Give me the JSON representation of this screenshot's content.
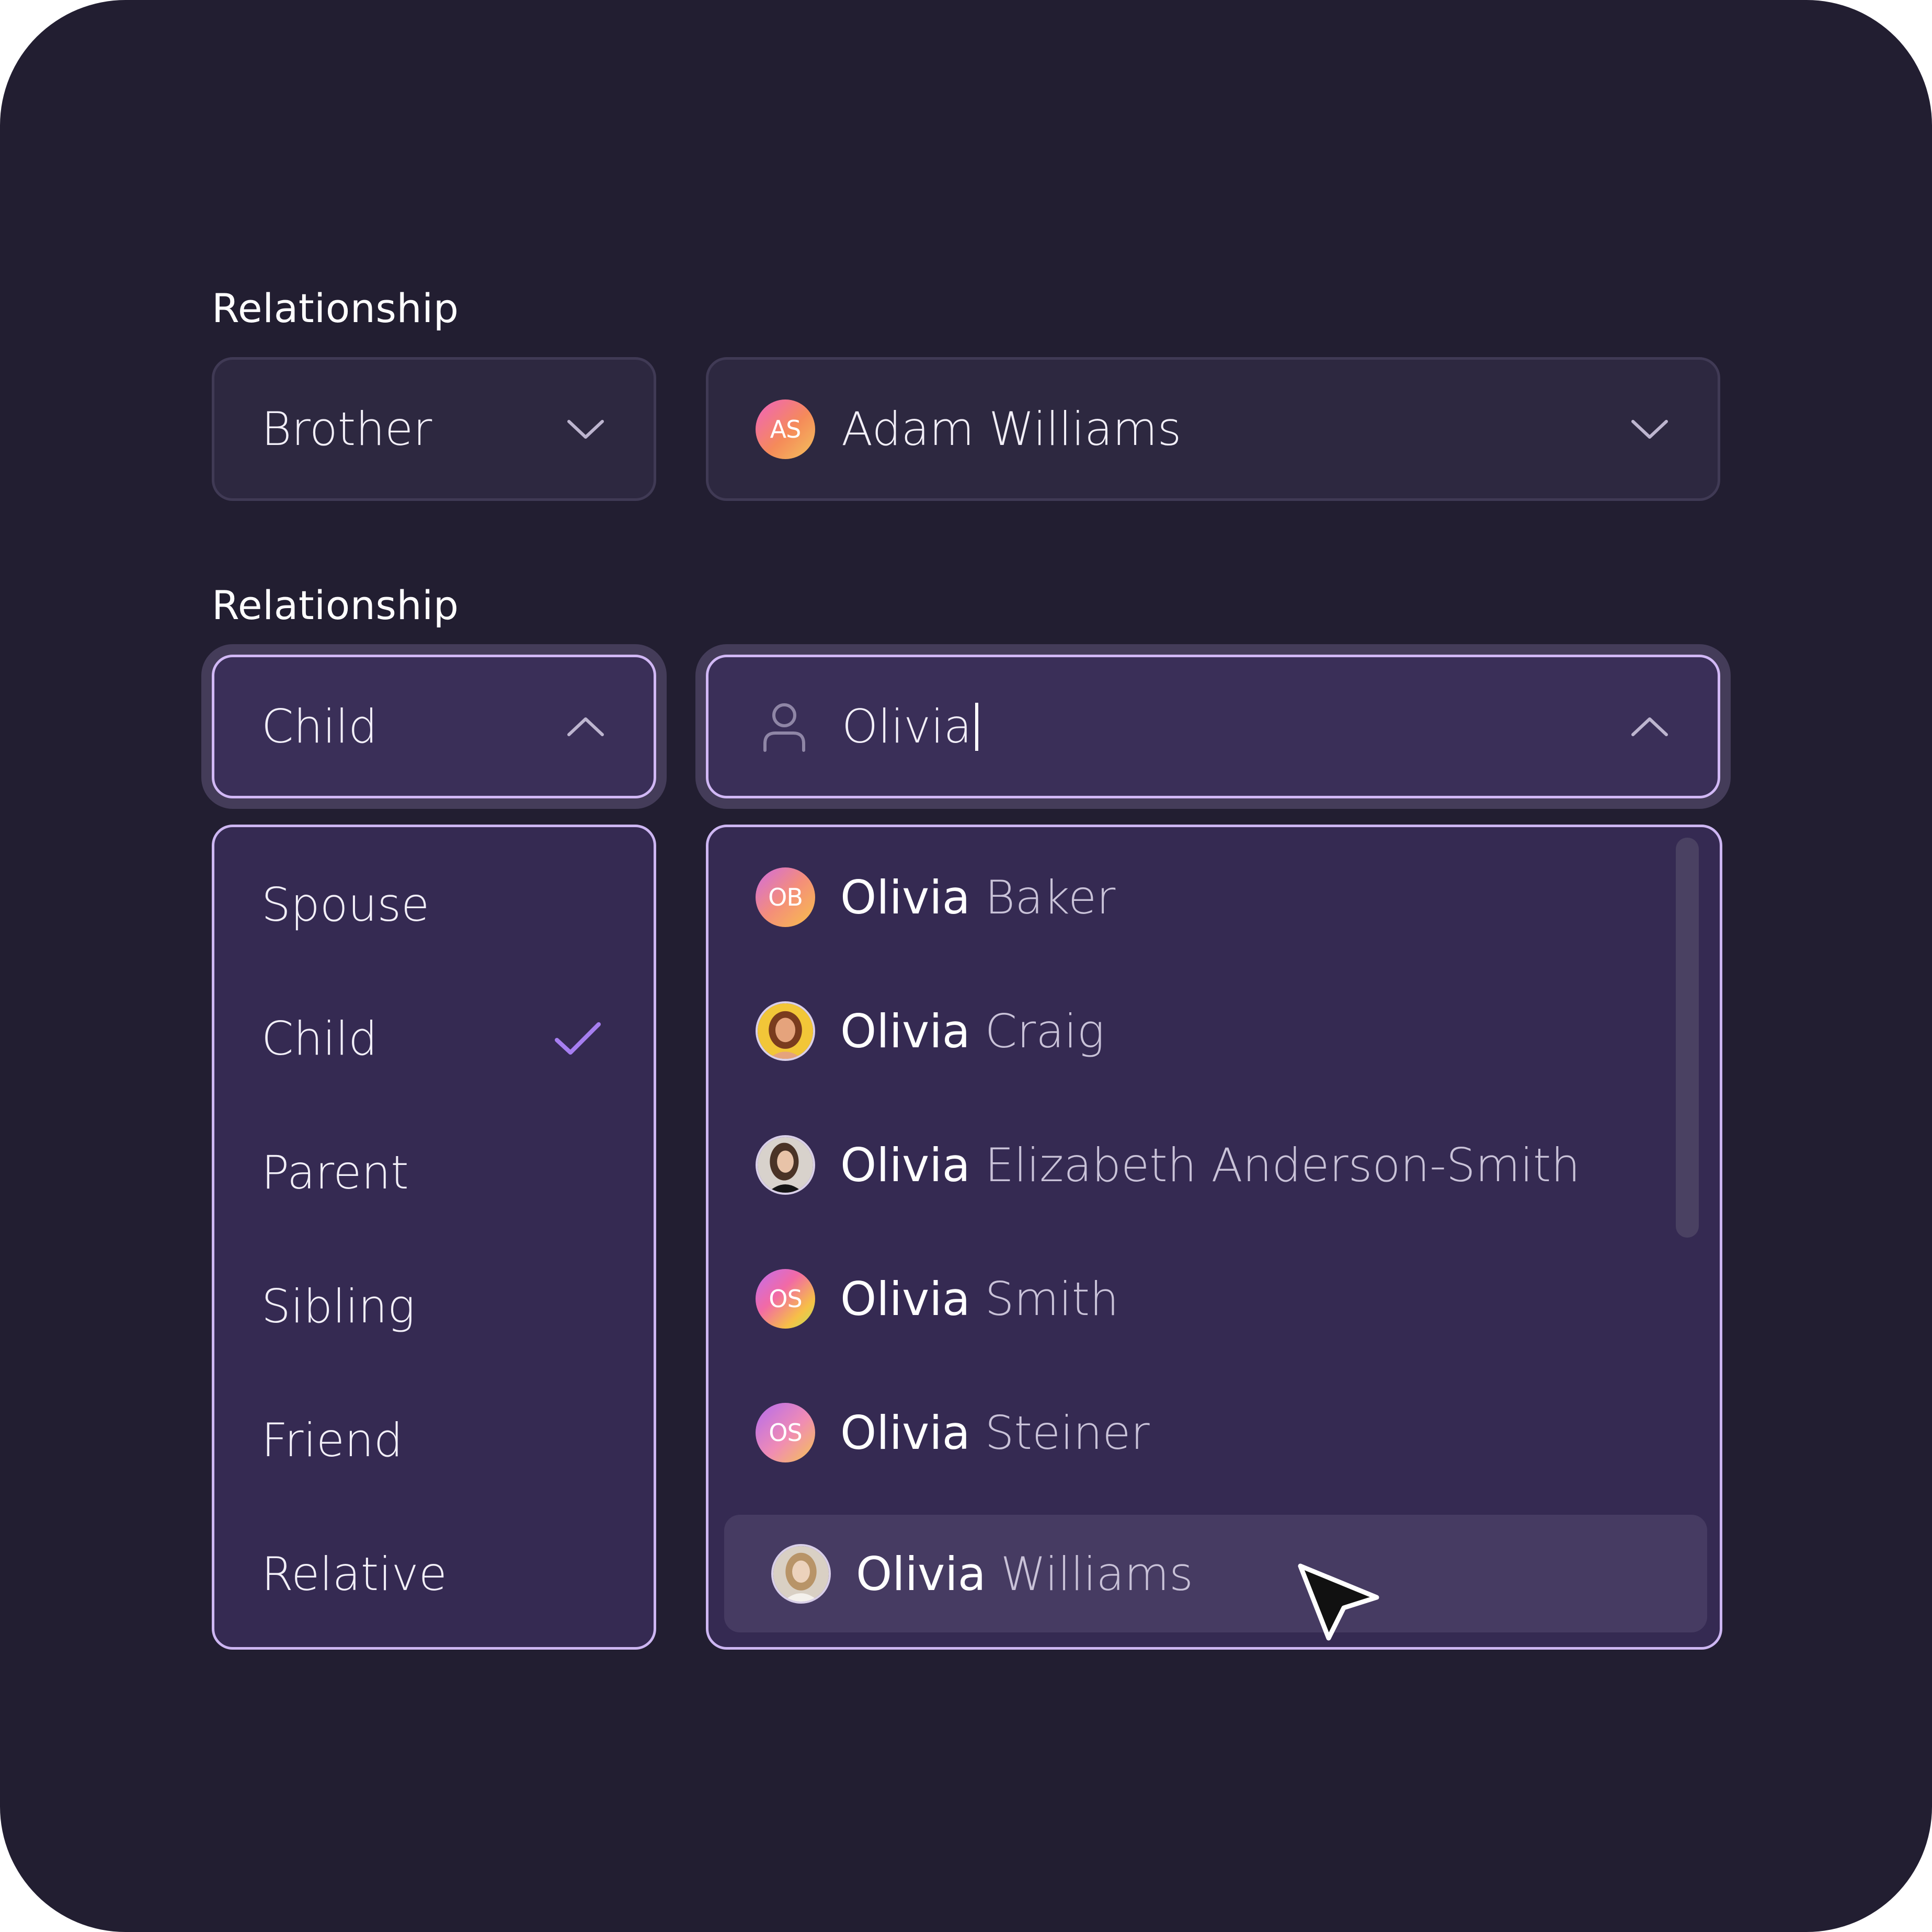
{
  "section1": {
    "label": "Relationship",
    "relationship_value": "Brother",
    "person": {
      "initials": "AS",
      "name": "Adam Williams"
    }
  },
  "section2": {
    "label": "Relationship",
    "relationship_value": "Child",
    "search_value": "Olivia"
  },
  "relationship_options": [
    {
      "label": "Spouse",
      "selected": false
    },
    {
      "label": "Child",
      "selected": true
    },
    {
      "label": "Parent",
      "selected": false
    },
    {
      "label": "Sibling",
      "selected": false
    },
    {
      "label": "Friend",
      "selected": false
    },
    {
      "label": "Relative",
      "selected": false
    }
  ],
  "people_results": [
    {
      "first": "Olivia",
      "last": "Baker",
      "initials": "OB",
      "avatar": "initials"
    },
    {
      "first": "Olivia",
      "last": "Craig",
      "initials": "",
      "avatar": "photo"
    },
    {
      "first": "Olivia",
      "last": "Elizabeth Anderson-Smith",
      "initials": "",
      "avatar": "photo"
    },
    {
      "first": "Olivia",
      "last": "Smith",
      "initials": "OS",
      "avatar": "initials"
    },
    {
      "first": "Olivia",
      "last": "Steiner",
      "initials": "OS",
      "avatar": "initials"
    },
    {
      "first": "Olivia",
      "last": "Williams",
      "initials": "",
      "avatar": "photo",
      "hovered": true
    }
  ],
  "colors": {
    "background": "#221e31",
    "field_closed": "#2d2840",
    "field_open": "#3a2f58",
    "accent_border": "#d1b8f5",
    "check": "#a67ef0"
  }
}
